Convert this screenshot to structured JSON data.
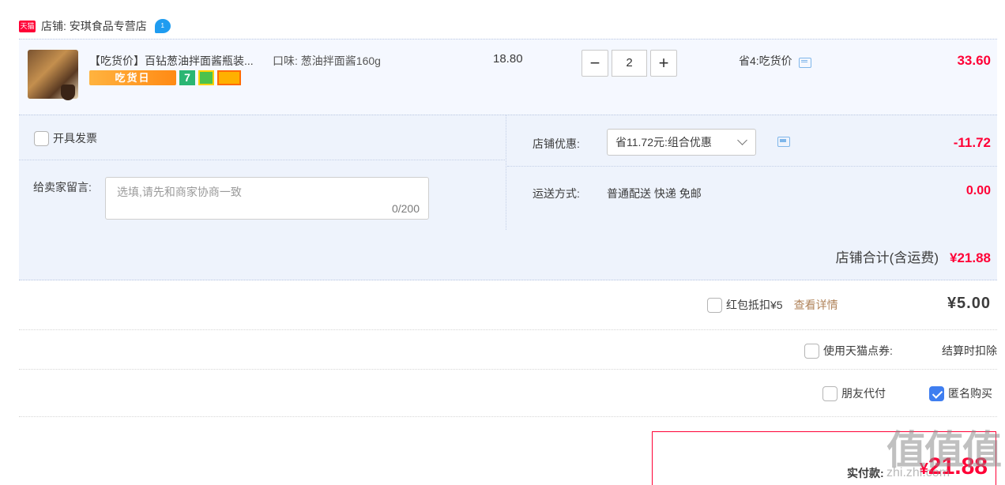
{
  "shop": {
    "badge": "天猫",
    "label": "店铺: 安琪食品专营店",
    "chat_badge": "1"
  },
  "item": {
    "title": "【吃货价】百钻葱油拌面酱瓶装...",
    "spec": "口味: 葱油拌面酱160g",
    "tag_day": "吃货日",
    "tag_seven": "7",
    "unit_price": "18.80",
    "quantity": "2",
    "minus": "−",
    "plus": "+",
    "promo": "省4:吃货价",
    "subtotal": "33.60",
    "icons": [
      "product-thumbnail",
      "chat-icon"
    ]
  },
  "order": {
    "invoice_label": "开具发票",
    "message_label": "给卖家留言:",
    "message_placeholder": "选填,请先和商家协商一致",
    "message_count": "0/200",
    "discount_label": "店铺优惠:",
    "discount_select": "省11.72元:组合优惠",
    "discount_amount": "-11.72",
    "shipping_label": "运送方式:",
    "shipping_method": "普通配送 快递 免邮",
    "shipping_amount": "0.00",
    "shop_total_label": "店铺合计(含运费)",
    "shop_total_value": "¥21.88"
  },
  "options": {
    "redpack_label": "红包抵扣¥5",
    "redpack_link": "查看详情",
    "redpack_amount": "¥5.00",
    "points_label": "使用天猫点券:",
    "points_note": "结算时扣除",
    "friend_label": "朋友代付",
    "anon_label": "匿名购买",
    "anon_checked": true
  },
  "payment": {
    "label": "实付款:",
    "currency": "¥",
    "amount": "21.88"
  },
  "watermark": {
    "text": "值值值",
    "sub": "zhi.zhi.com"
  },
  "colors": {
    "accent_red": "#ff0036",
    "panel_bg": "#eef3fc",
    "checkbox_blue": "#3f7ef0",
    "link_brown": "#b0835a"
  }
}
